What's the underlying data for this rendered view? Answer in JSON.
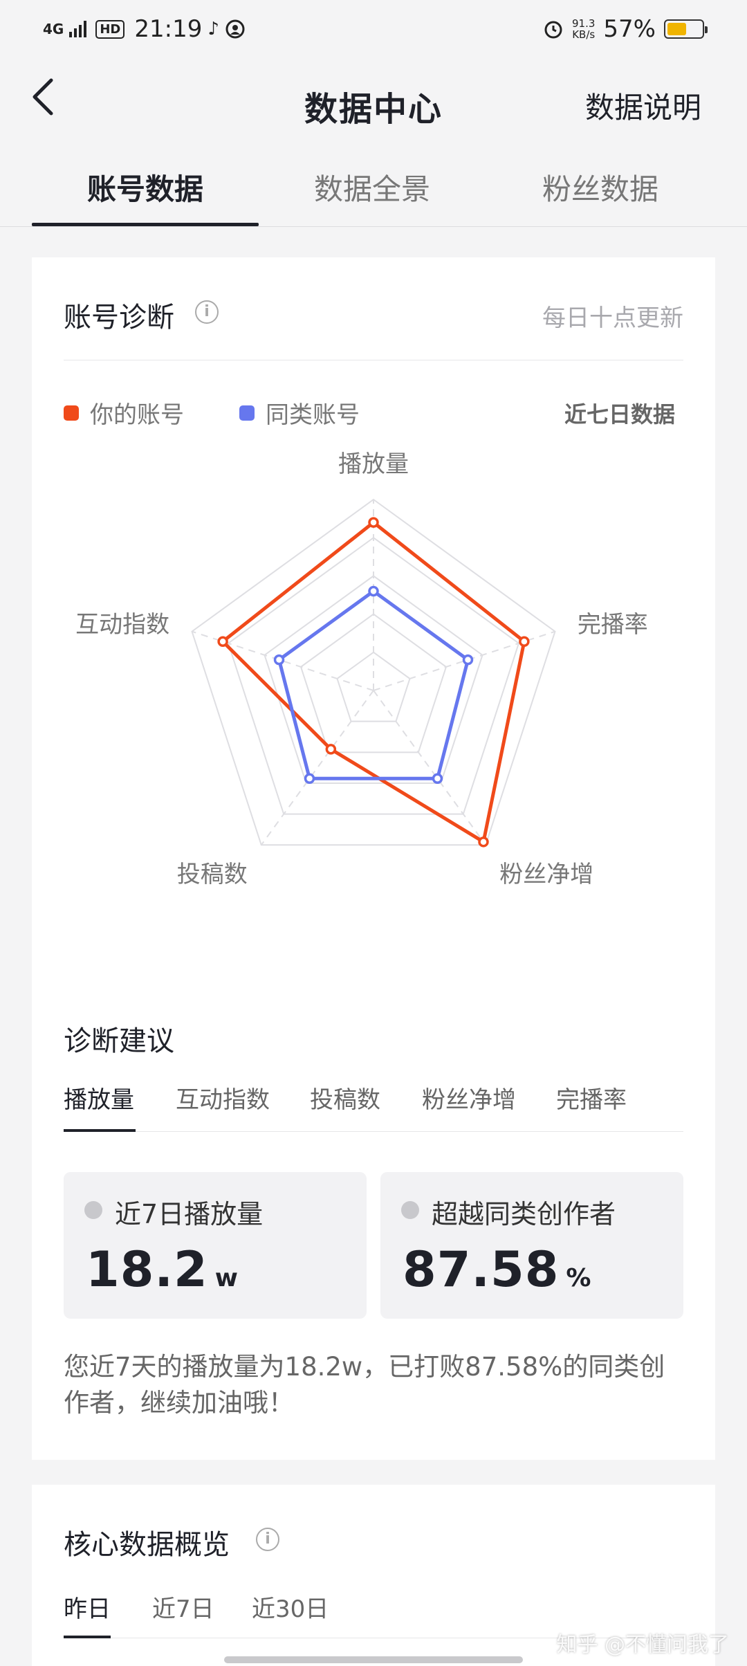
{
  "status_bar": {
    "network": "4G",
    "hd": "HD",
    "time": "21:19",
    "net_speed_value": "91.3",
    "net_speed_unit": "KB/s",
    "battery": "57%",
    "battery_level": 0.57,
    "icons": [
      "signal-icon",
      "hd-icon",
      "tiktok-icon",
      "notification-icon",
      "alarm-icon",
      "battery-icon"
    ]
  },
  "nav": {
    "title": "数据中心",
    "right_label": "数据说明",
    "back_icon": "chevron-left-icon"
  },
  "tabs": [
    "账号数据",
    "数据全景",
    "粉丝数据"
  ],
  "active_tab": "账号数据",
  "diagnosis": {
    "title": "账号诊断",
    "update_note": "每日十点更新",
    "legend": [
      {
        "label": "你的账号",
        "color": "#f04a1a"
      },
      {
        "label": "同类账号",
        "color": "#6677ee"
      }
    ],
    "period": "近七日数据"
  },
  "chart_data": {
    "type": "radar",
    "axes": [
      "播放量",
      "完播率",
      "粉丝净增",
      "投稿数",
      "互动指数"
    ],
    "series": [
      {
        "name": "你的账号",
        "color": "#f04a1a",
        "values": [
          0.88,
          0.83,
          0.98,
          0.38,
          0.83
        ]
      },
      {
        "name": "同类账号",
        "color": "#6677ee",
        "values": [
          0.52,
          0.52,
          0.57,
          0.57,
          0.52
        ]
      }
    ],
    "rings": 5,
    "range": [
      0,
      1
    ]
  },
  "suggestion": {
    "title": "诊断建议",
    "tabs": [
      "播放量",
      "互动指数",
      "投稿数",
      "粉丝净增",
      "完播率"
    ],
    "active_tab": "播放量",
    "metrics": [
      {
        "label": "近7日播放量",
        "value": "18.2",
        "unit": "w"
      },
      {
        "label": "超越同类创作者",
        "value": "87.58",
        "unit": "%"
      }
    ],
    "summary": "您近7天的播放量为18.2w，已打败87.58%的同类创作者，继续加油哦！"
  },
  "overview": {
    "title": "核心数据概览",
    "tabs": [
      "昨日",
      "近7日",
      "近30日"
    ],
    "active_tab": "昨日"
  },
  "watermark": "知乎 @不懂问我了"
}
